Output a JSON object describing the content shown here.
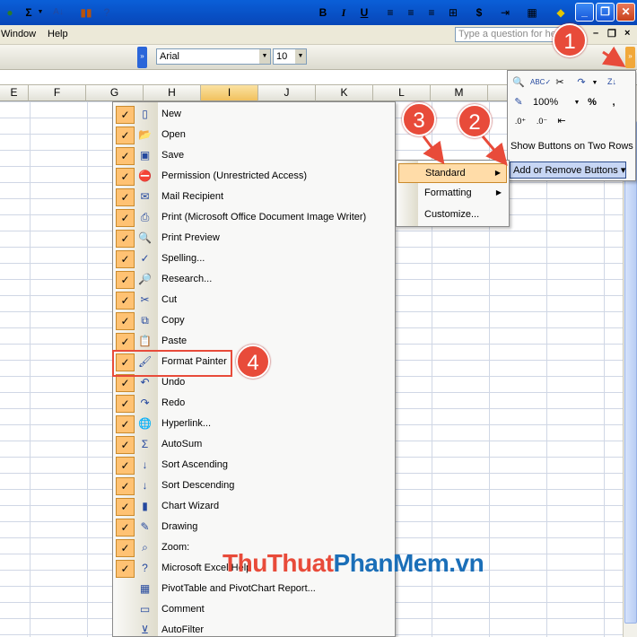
{
  "window": {
    "minimize": "_",
    "restore": "❐",
    "close": "✕"
  },
  "menubar": {
    "items": [
      {
        "label": "Window"
      },
      {
        "label": "Help"
      }
    ],
    "help_placeholder": "Type a question for help",
    "doc_minimize": "–",
    "doc_restore": "❐",
    "doc_close": "×"
  },
  "toolbar": {
    "font_name": "Arial",
    "font_size": "10",
    "bold": "B",
    "italic": "I",
    "underline": "U",
    "currency": "$",
    "autosum": "Σ"
  },
  "columns": [
    "E",
    "F",
    "G",
    "H",
    "I",
    "J",
    "K",
    "L",
    "M"
  ],
  "selected_column": "I",
  "commands": [
    {
      "label": "New",
      "icon": "new-document-icon",
      "checked": true
    },
    {
      "label": "Open",
      "icon": "open-folder-icon",
      "checked": true
    },
    {
      "label": "Save",
      "icon": "save-disk-icon",
      "checked": true
    },
    {
      "label": "Permission (Unrestricted Access)",
      "icon": "permission-icon",
      "checked": true
    },
    {
      "label": "Mail Recipient",
      "icon": "mail-recipient-icon",
      "checked": true
    },
    {
      "label": "Print (Microsoft Office Document Image Writer)",
      "icon": "printer-icon",
      "checked": true
    },
    {
      "label": "Print Preview",
      "icon": "print-preview-icon",
      "checked": true
    },
    {
      "label": "Spelling...",
      "icon": "spelling-icon",
      "checked": true
    },
    {
      "label": "Research...",
      "icon": "research-icon",
      "checked": true
    },
    {
      "label": "Cut",
      "icon": "scissors-icon",
      "checked": true
    },
    {
      "label": "Copy",
      "icon": "copy-icon",
      "checked": true
    },
    {
      "label": "Paste",
      "icon": "paste-icon",
      "checked": true
    },
    {
      "label": "Format Painter",
      "icon": "format-painter-icon",
      "checked": true
    },
    {
      "label": "Undo",
      "icon": "undo-icon",
      "checked": true
    },
    {
      "label": "Redo",
      "icon": "redo-icon",
      "checked": true
    },
    {
      "label": "Hyperlink...",
      "icon": "hyperlink-icon",
      "checked": true
    },
    {
      "label": "AutoSum",
      "icon": "sigma-icon",
      "checked": true
    },
    {
      "label": "Sort Ascending",
      "icon": "sort-ascending-icon",
      "checked": true
    },
    {
      "label": "Sort Descending",
      "icon": "sort-descending-icon",
      "checked": true
    },
    {
      "label": "Chart Wizard",
      "icon": "chart-wizard-icon",
      "checked": true
    },
    {
      "label": "Drawing",
      "icon": "drawing-icon",
      "checked": true
    },
    {
      "label": "Zoom:",
      "icon": "zoom-icon",
      "checked": true
    },
    {
      "label": "Microsoft Excel Help",
      "icon": "help-icon",
      "checked": true
    },
    {
      "label": "PivotTable and PivotChart Report...",
      "icon": "pivot-icon",
      "checked": false
    },
    {
      "label": "Comment",
      "icon": "comment-icon",
      "checked": false
    },
    {
      "label": "AutoFilter",
      "icon": "autofilter-icon",
      "checked": false
    }
  ],
  "popup": {
    "zoom_value": "100%",
    "percent": "%",
    "comma": ",",
    "show_two_rows": "Show Buttons on Two Rows",
    "add_remove": "Add or Remove Buttons ▾"
  },
  "submenu": {
    "items": [
      {
        "label": "Standard",
        "has_arrow": true,
        "highlighted": true
      },
      {
        "label": "Formatting",
        "has_arrow": true,
        "highlighted": false
      },
      {
        "label": "Customize...",
        "has_arrow": false,
        "highlighted": false
      }
    ]
  },
  "annotations": {
    "step1": "1",
    "step2": "2",
    "step3": "3",
    "step4": "4",
    "arrow_color": "#e84b3a"
  },
  "watermark": {
    "part1": "ThuThuat",
    "part2": "PhanMem.vn"
  },
  "colors": {
    "accent_check": "#ffc273",
    "title_blue": "#0a5fd8",
    "callout_red": "#e84b3a"
  }
}
